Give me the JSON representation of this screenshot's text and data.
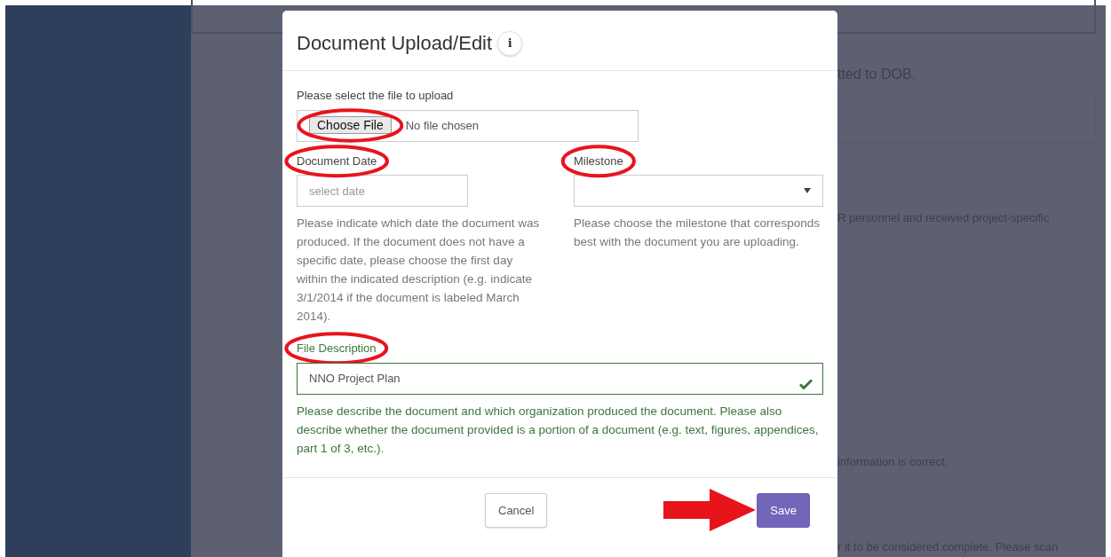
{
  "background": {
    "texts": [
      {
        "kind": "lead",
        "text": "tted to DOB."
      },
      {
        "kind": "body",
        "text": "R personnel and received project-specific"
      },
      {
        "kind": "body",
        "text": "information is correct."
      },
      {
        "kind": "body",
        "text": "r it to be considered complete. Please scan"
      }
    ]
  },
  "modal": {
    "title": "Document Upload/Edit",
    "info_icon": "i",
    "file": {
      "label": "Please select the file to upload",
      "button": "Choose File",
      "status": "No file chosen",
      "circled": true
    },
    "date": {
      "label": "Document Date",
      "placeholder": "select date",
      "help": "Please indicate which date the document was produced. If the document does not have a specific date, please choose the first day within the indicated description (e.g. indicate 3/1/2014 if the document is labeled March 2014).",
      "circled": true
    },
    "milestone": {
      "label": "Milestone",
      "help": "Please choose the milestone that corresponds best with the document you are uploading.",
      "circled": true
    },
    "description": {
      "label": "File Description",
      "value": "NNO Project Plan",
      "valid": true,
      "help": "Please describe the document and which organization produced the document. Please also describe whether the document provided is a portion of a document (e.g. text, figures, appendices, part 1 of 3, etc.).",
      "circled": true
    },
    "buttons": [
      {
        "kind": "default",
        "label": "Cancel",
        "pointed": false
      },
      {
        "kind": "primary",
        "label": "Save",
        "pointed": true
      }
    ]
  }
}
